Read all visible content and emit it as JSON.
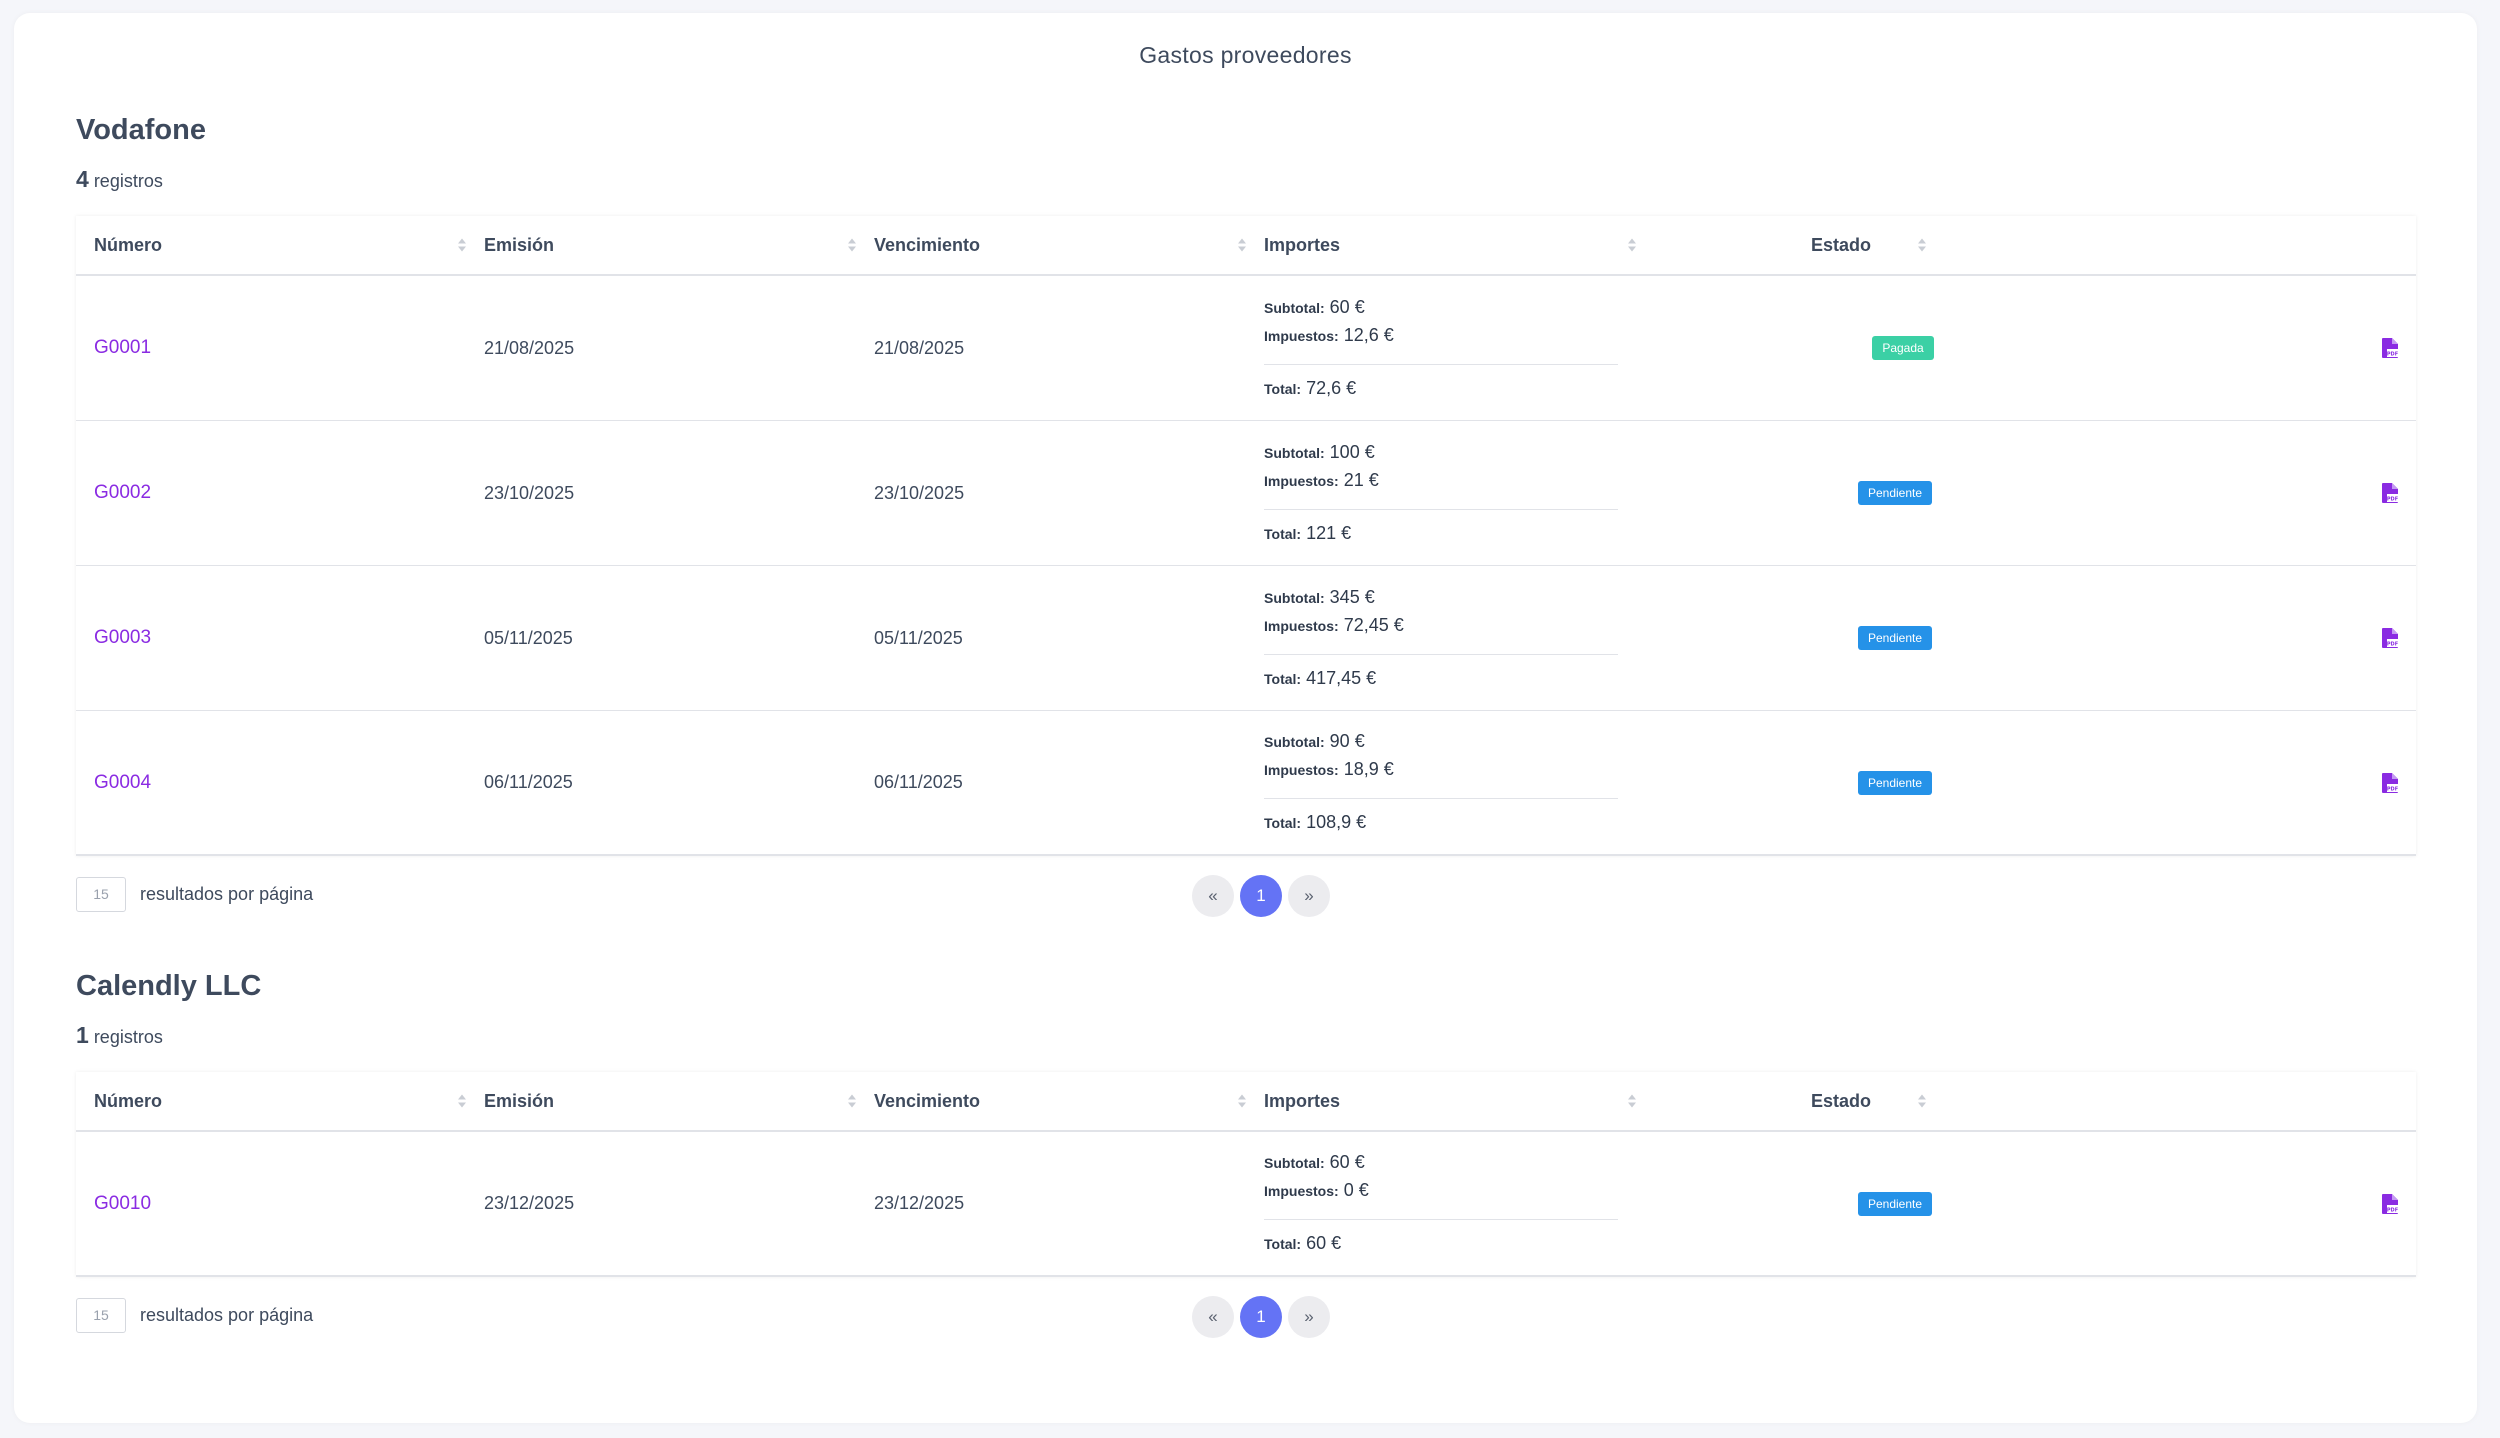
{
  "page": {
    "title": "Gastos proveedores"
  },
  "columns": {
    "numero": "Número",
    "emision": "Emisión",
    "vencimiento": "Vencimiento",
    "importes": "Importes",
    "estado": "Estado"
  },
  "amount_labels": {
    "subtotal": "Subtotal:",
    "impuestos": "Impuestos:",
    "total": "Total:"
  },
  "status_colors": {
    "Pagada": "#3bd0a5",
    "Pendiente": "#2592e8"
  },
  "accent_color": "#6473f5",
  "link_color": "#8a2be2",
  "pdf_icon": "file-pdf-icon",
  "suppliers": [
    {
      "name": "Vodafone",
      "count": "4",
      "count_label": "registros",
      "rows": [
        {
          "numero": "G0001",
          "emision": "21/08/2025",
          "vencimiento": "21/08/2025",
          "subtotal": "60 €",
          "impuestos": "12,6 €",
          "total": "72,6 €",
          "estado": "Pagada"
        },
        {
          "numero": "G0002",
          "emision": "23/10/2025",
          "vencimiento": "23/10/2025",
          "subtotal": "100 €",
          "impuestos": "21 €",
          "total": "121 €",
          "estado": "Pendiente"
        },
        {
          "numero": "G0003",
          "emision": "05/11/2025",
          "vencimiento": "05/11/2025",
          "subtotal": "345 €",
          "impuestos": "72,45 €",
          "total": "417,45 €",
          "estado": "Pendiente"
        },
        {
          "numero": "G0004",
          "emision": "06/11/2025",
          "vencimiento": "06/11/2025",
          "subtotal": "90 €",
          "impuestos": "18,9 €",
          "total": "108,9 €",
          "estado": "Pendiente"
        }
      ],
      "per_page": "15",
      "per_page_label": "resultados por página",
      "pagination": {
        "prev": "«",
        "current": "1",
        "next": "»"
      }
    },
    {
      "name": "Calendly LLC",
      "count": "1",
      "count_label": "registros",
      "rows": [
        {
          "numero": "G0010",
          "emision": "23/12/2025",
          "vencimiento": "23/12/2025",
          "subtotal": "60 €",
          "impuestos": "0 €",
          "total": "60 €",
          "estado": "Pendiente"
        }
      ],
      "per_page": "15",
      "per_page_label": "resultados por página",
      "pagination": {
        "prev": "«",
        "current": "1",
        "next": "»"
      }
    }
  ]
}
